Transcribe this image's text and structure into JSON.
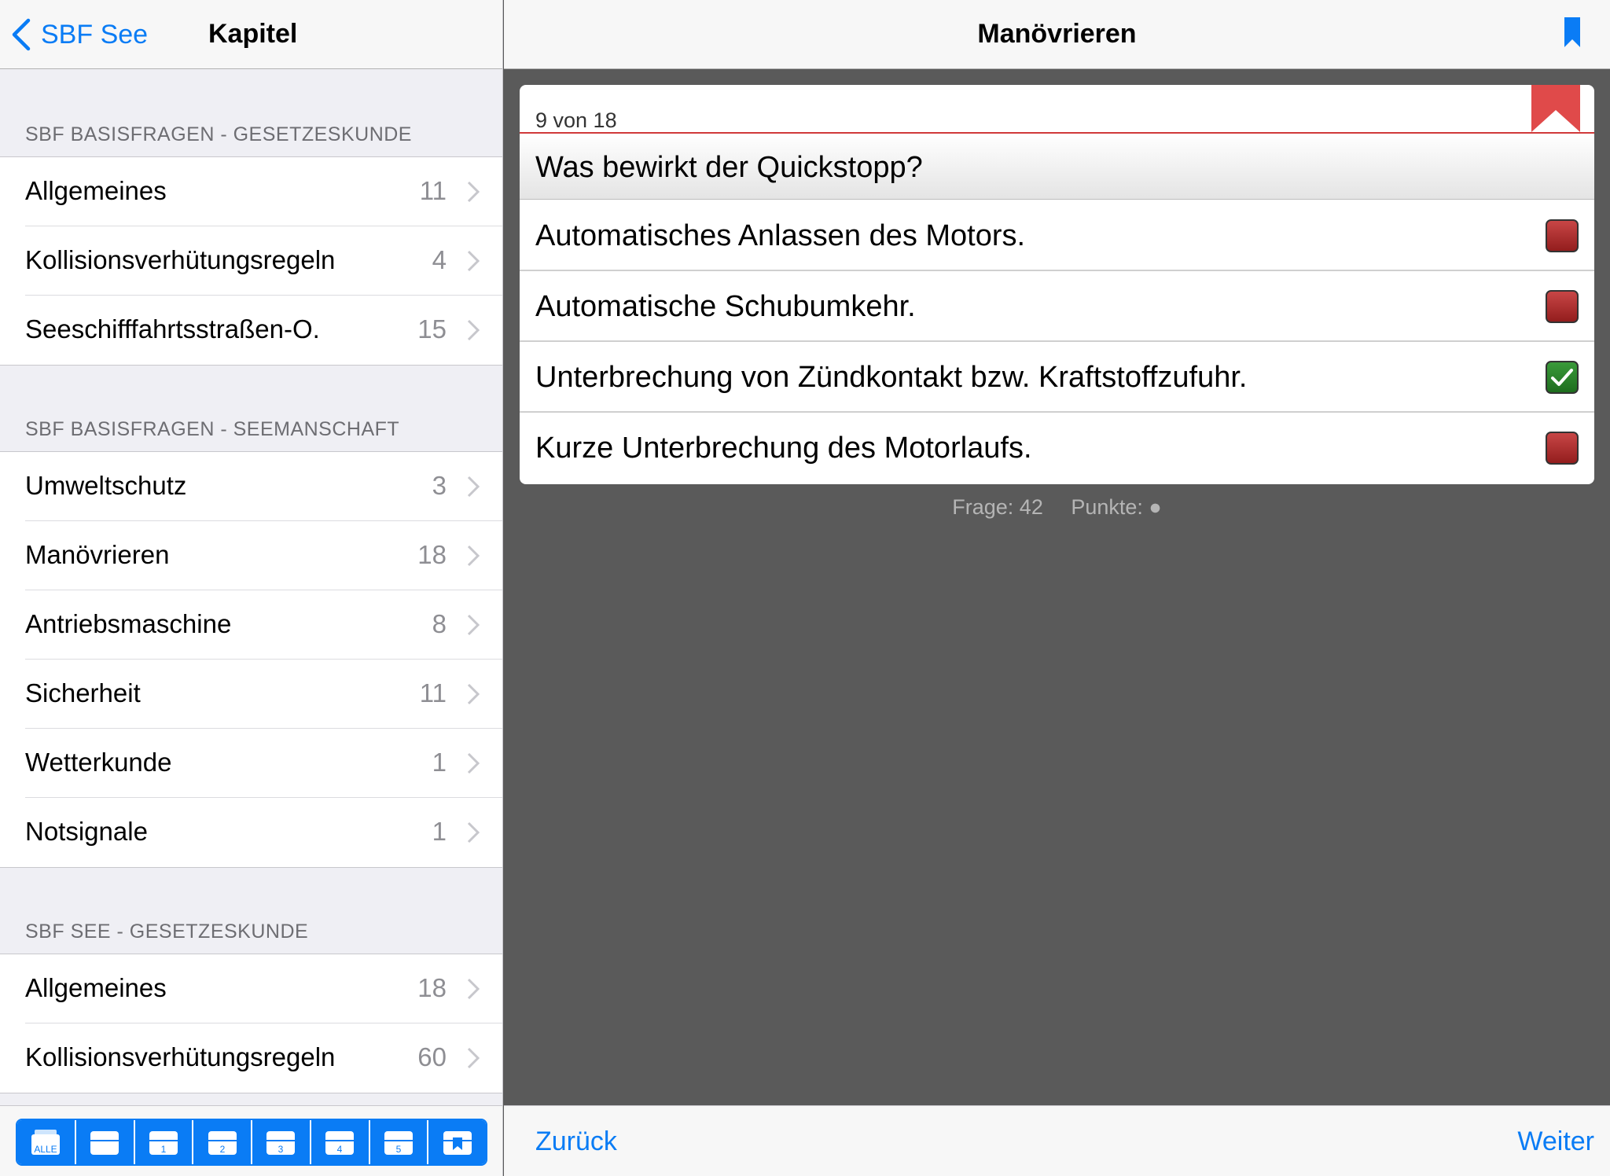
{
  "sidebar": {
    "back_label": "SBF See",
    "title": "Kapitel",
    "sections": [
      {
        "header": "SBF BASISFRAGEN - GESETZESKUNDE",
        "items": [
          {
            "label": "Allgemeines",
            "count": "11"
          },
          {
            "label": "Kollisionsverhütungsregeln",
            "count": "4"
          },
          {
            "label": "Seeschifffahrtsstraßen-O.",
            "count": "15"
          }
        ]
      },
      {
        "header": "SBF BASISFRAGEN - SEEMANSCHAFT",
        "items": [
          {
            "label": "Umweltschutz",
            "count": "3"
          },
          {
            "label": "Manövrieren",
            "count": "18"
          },
          {
            "label": "Antriebsmaschine",
            "count": "8"
          },
          {
            "label": "Sicherheit",
            "count": "11"
          },
          {
            "label": "Wetterkunde",
            "count": "1"
          },
          {
            "label": "Notsignale",
            "count": "1"
          }
        ]
      },
      {
        "header": "SBF SEE - GESETZESKUNDE",
        "items": [
          {
            "label": "Allgemeines",
            "count": "18"
          },
          {
            "label": "Kollisionsverhütungsregeln",
            "count": "60"
          }
        ]
      }
    ],
    "tabs": [
      {
        "icon": "box-all-icon",
        "label": "ALLE"
      },
      {
        "icon": "box-icon",
        "label": ""
      },
      {
        "icon": "box-1-icon",
        "label": "1"
      },
      {
        "icon": "box-2-icon",
        "label": "2"
      },
      {
        "icon": "box-3-icon",
        "label": "3"
      },
      {
        "icon": "box-4-icon",
        "label": "4"
      },
      {
        "icon": "box-5-icon",
        "label": "5"
      },
      {
        "icon": "box-bookmark-icon",
        "label": ""
      }
    ]
  },
  "main": {
    "title": "Manövrieren",
    "counter": "9 von 18",
    "question": "Was bewirkt der Quickstopp?",
    "answers": [
      {
        "text": "Automatisches Anlassen des Motors.",
        "state": "wrong"
      },
      {
        "text": "Automatische Schubumkehr.",
        "state": "wrong"
      },
      {
        "text": "Unterbrechung von Zündkontakt bzw. Kraftstoffzufuhr.",
        "state": "right"
      },
      {
        "text": "Kurze Unterbrechung des Motorlaufs.",
        "state": "wrong"
      }
    ],
    "status_frage": "Frage: 42",
    "status_punkte": "Punkte: ●",
    "back_button": "Zurück",
    "next_button": "Weiter"
  },
  "colors": {
    "accent": "#0a7cf5",
    "flag_red": "#e04a4a",
    "wrong_red": "#a82828",
    "right_green": "#2e8b2e"
  }
}
